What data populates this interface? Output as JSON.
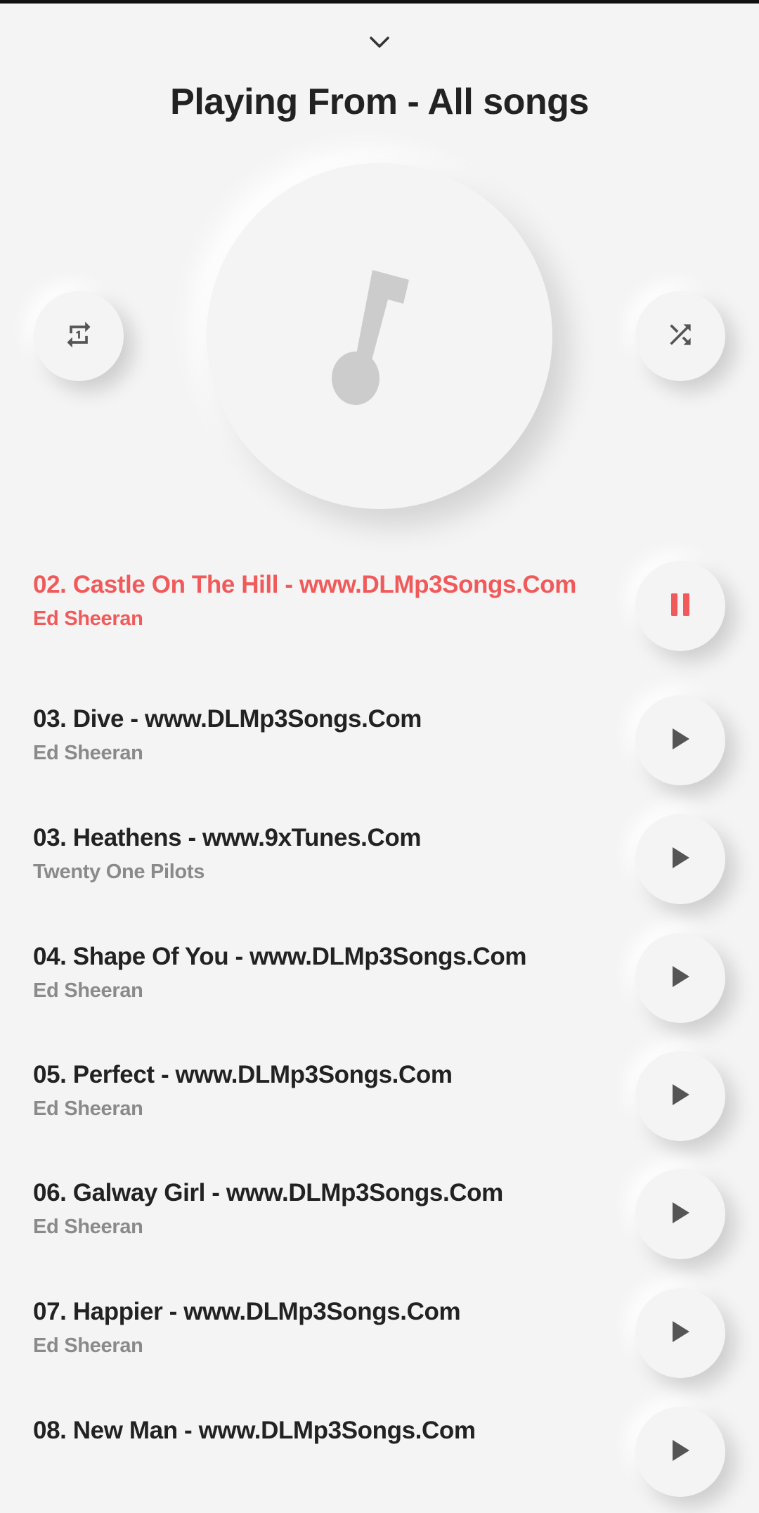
{
  "header": {
    "collapse_icon": "chevron-down-icon",
    "title": "Playing From - All songs"
  },
  "player": {
    "artwork_icon": "music-note-icon",
    "repeat_icon": "repeat-one-icon",
    "shuffle_icon": "shuffle-icon"
  },
  "colors": {
    "accent": "#f05a5a",
    "background": "#f4f4f4",
    "icon": "#555555",
    "artwork_icon": "#cccccc"
  },
  "songs": [
    {
      "title": "02. Castle On The Hill - www.DLMp3Songs.Com",
      "artist": "Ed Sheeran",
      "state": "playing",
      "icon": "pause-icon"
    },
    {
      "title": "03. Dive - www.DLMp3Songs.Com",
      "artist": "Ed Sheeran",
      "state": "idle",
      "icon": "play-icon"
    },
    {
      "title": "03. Heathens - www.9xTunes.Com",
      "artist": "Twenty One Pilots",
      "state": "idle",
      "icon": "play-icon"
    },
    {
      "title": "04. Shape Of You - www.DLMp3Songs.Com",
      "artist": "Ed Sheeran",
      "state": "idle",
      "icon": "play-icon"
    },
    {
      "title": "05. Perfect - www.DLMp3Songs.Com",
      "artist": "Ed Sheeran",
      "state": "idle",
      "icon": "play-icon"
    },
    {
      "title": "06. Galway Girl - www.DLMp3Songs.Com",
      "artist": "Ed Sheeran",
      "state": "idle",
      "icon": "play-icon"
    },
    {
      "title": "07. Happier - www.DLMp3Songs.Com",
      "artist": "Ed Sheeran",
      "state": "idle",
      "icon": "play-icon"
    },
    {
      "title": "08. New Man - www.DLMp3Songs.Com",
      "artist": "",
      "state": "idle",
      "icon": "play-icon"
    }
  ]
}
